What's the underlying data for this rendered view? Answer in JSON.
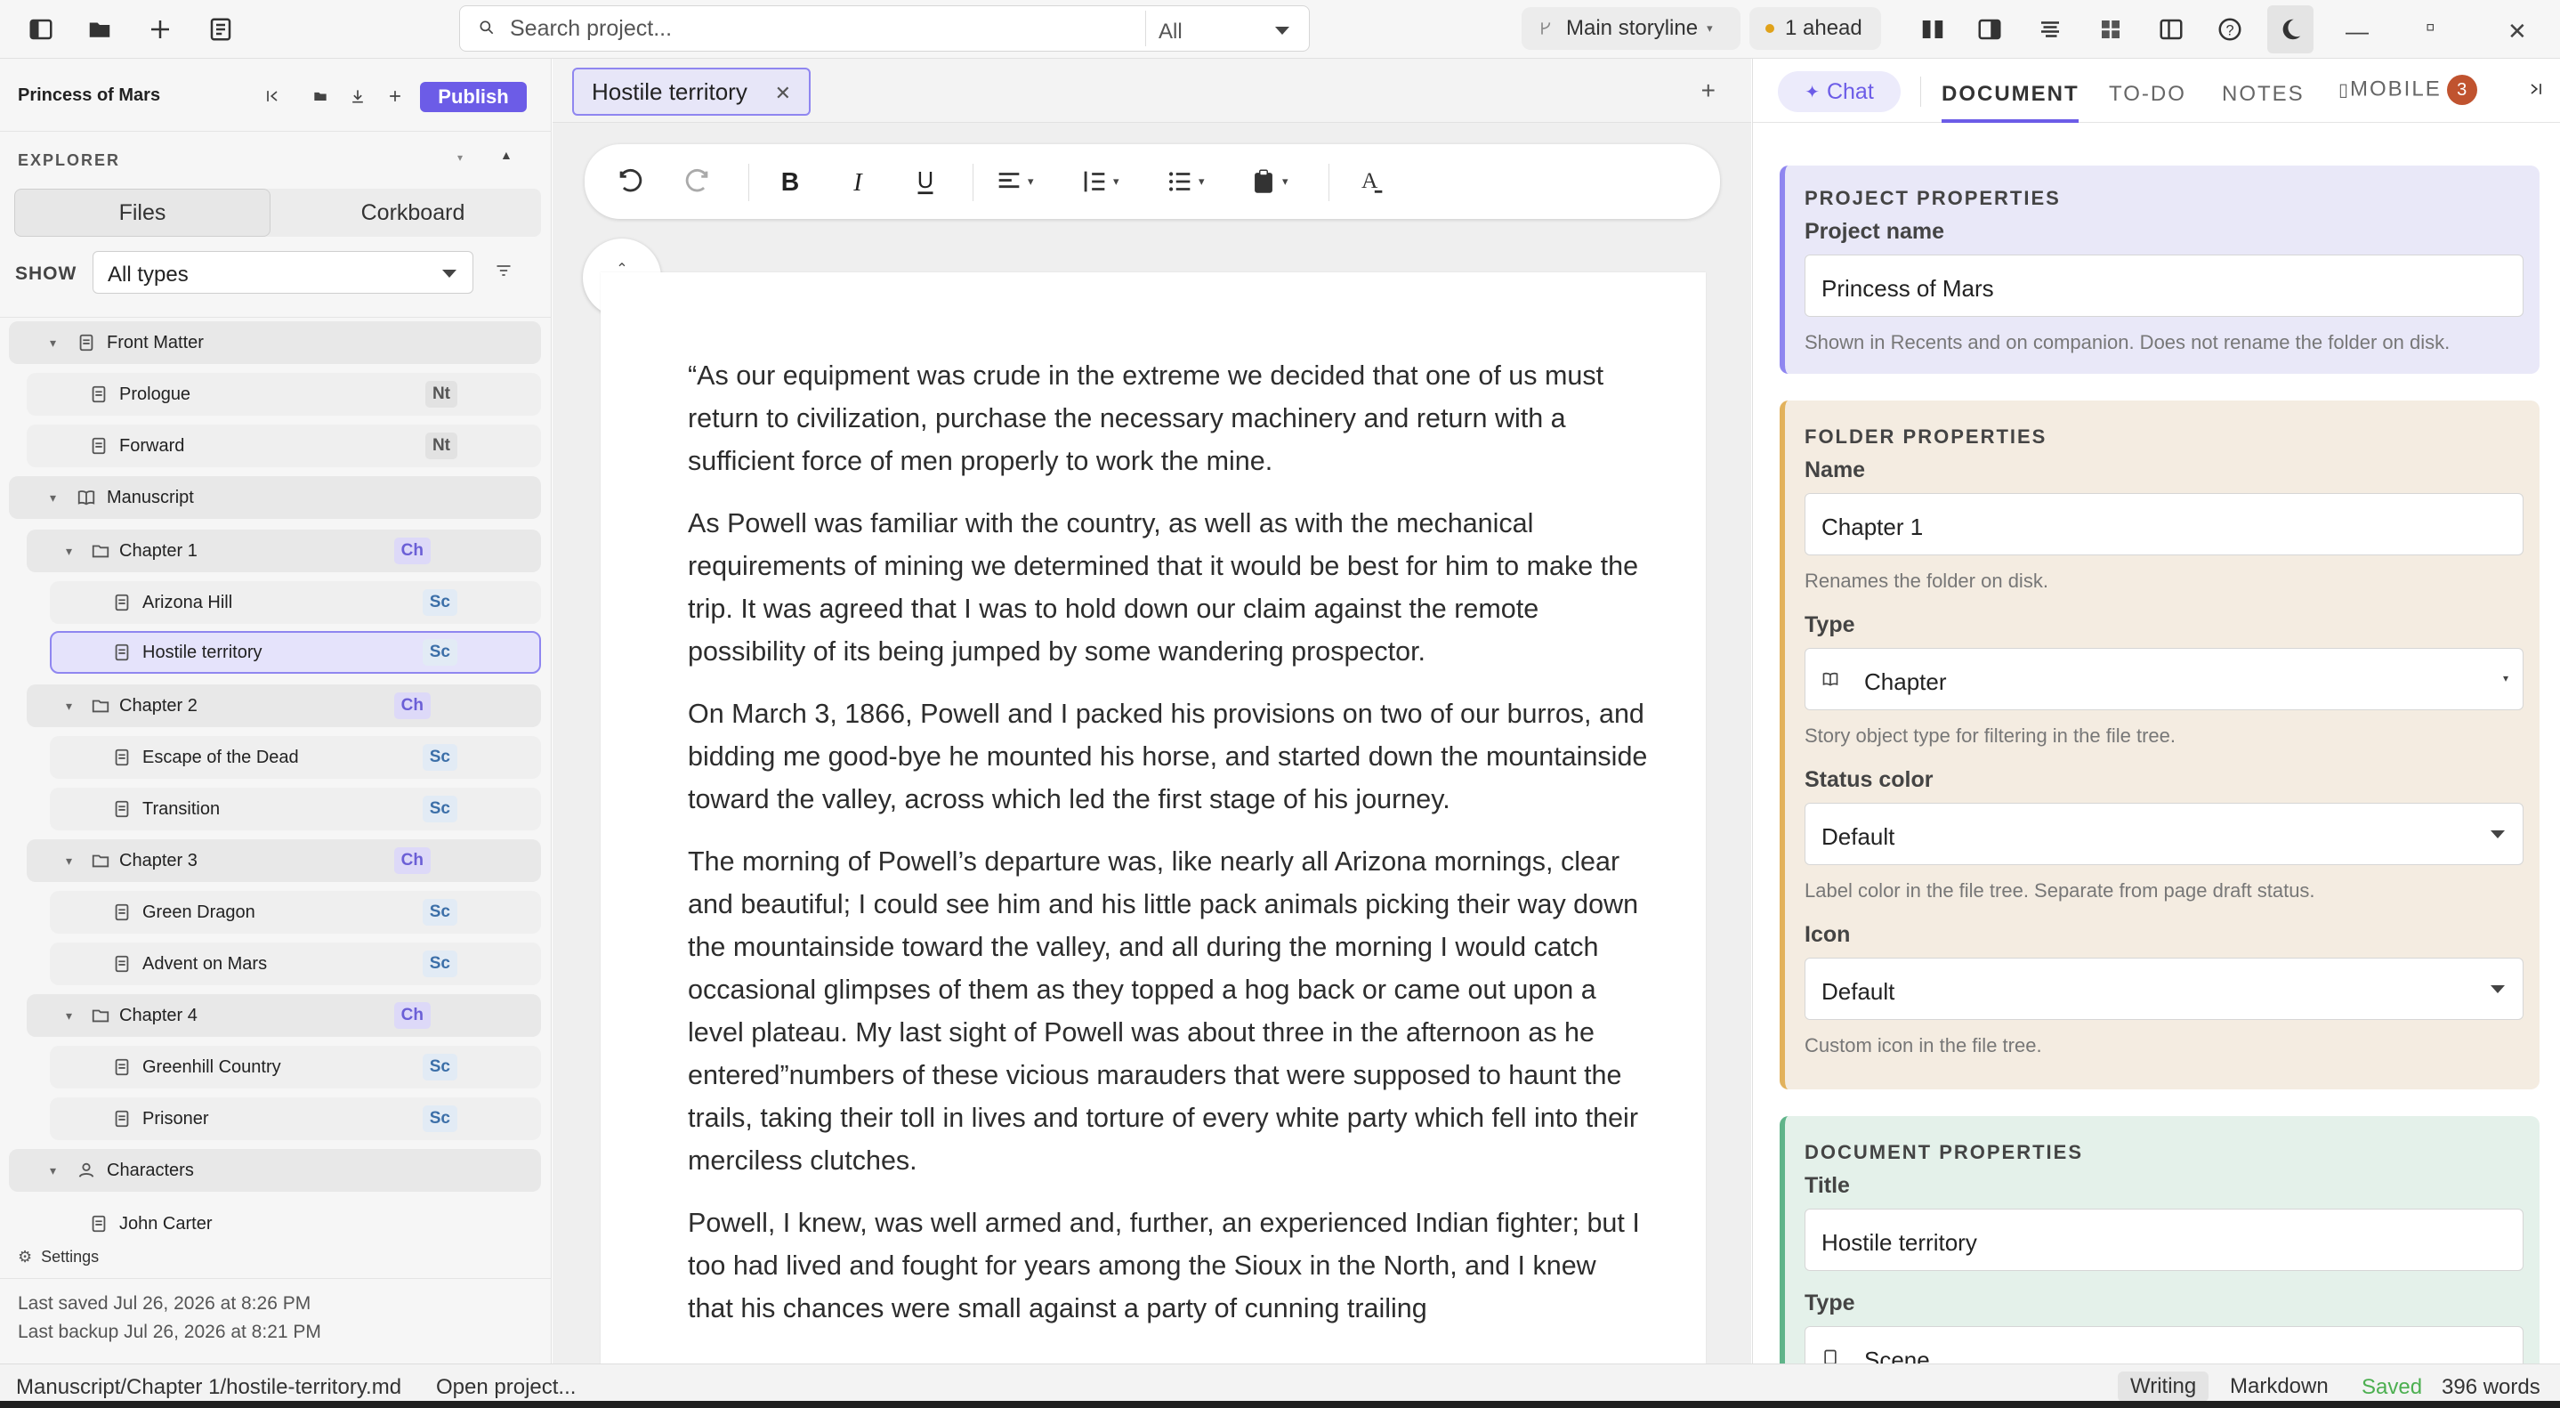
{
  "topbar": {
    "search_placeholder": "Search project...",
    "scope": "All",
    "storyline": "Main storyline",
    "ahead": "1 ahead",
    "accent": "#6c5ce7"
  },
  "sidebar": {
    "project_name": "Princess of Mars",
    "publish_label": "Publish",
    "explorer_label": "EXPLORER",
    "tabs": [
      "Files",
      "Corkboard"
    ],
    "show_label": "SHOW",
    "type_filter": "All types",
    "tree": [
      {
        "label": "Front Matter",
        "kind": "group",
        "icon": "document-icon"
      },
      {
        "label": "Prologue",
        "badge": "Nt",
        "icon": "document-icon"
      },
      {
        "label": "Forward",
        "badge": "Nt",
        "icon": "document-icon"
      },
      {
        "label": "Manuscript",
        "kind": "group",
        "icon": "book-icon"
      },
      {
        "label": "Chapter 1",
        "badge": "Ch",
        "icon": "folder-icon"
      },
      {
        "label": "Arizona Hill",
        "badge": "Sc",
        "icon": "document-icon"
      },
      {
        "label": "Hostile territory",
        "badge": "Sc",
        "icon": "document-icon",
        "selected": true
      },
      {
        "label": "Chapter 2",
        "badge": "Ch",
        "icon": "folder-icon"
      },
      {
        "label": "Escape of the Dead",
        "badge": "Sc",
        "icon": "document-icon"
      },
      {
        "label": "Transition",
        "badge": "Sc",
        "icon": "document-icon"
      },
      {
        "label": "Chapter 3",
        "badge": "Ch",
        "icon": "folder-icon"
      },
      {
        "label": "Green Dragon",
        "badge": "Sc",
        "icon": "document-icon"
      },
      {
        "label": "Advent on Mars",
        "badge": "Sc",
        "icon": "document-icon"
      },
      {
        "label": "Chapter 4",
        "badge": "Ch",
        "icon": "folder-icon"
      },
      {
        "label": "Greenhill Country",
        "badge": "Sc",
        "icon": "document-icon"
      },
      {
        "label": "Prisoner",
        "badge": "Sc",
        "icon": "document-icon"
      },
      {
        "label": "Characters",
        "kind": "group",
        "icon": "person-icon"
      },
      {
        "label": "John Carter",
        "icon": "document-icon"
      }
    ],
    "settings_label": "Settings",
    "last_saved": "Last saved Jul 26, 2026 at 8:26 PM",
    "last_backup": "Last backup Jul 26, 2026 at 8:21 PM"
  },
  "editor": {
    "tab_title": "Hostile territory",
    "page_button": "page",
    "paragraphs": [
      "“As our equipment was crude in the extreme we decided that one of us must return to civilization, purchase the necessary machinery and return with a sufficient force of men properly to work the mine.",
      "As Powell was familiar with the country, as well as with the mechanical requirements of mining we determined that it would be best for him to make the trip. It was agreed that I was to hold down our claim against the remote possibility of its being jumped by some wandering prospector.",
      "On March 3, 1866, Powell and I packed his provisions on two of our burros, and bidding me good-bye he mounted his horse, and started down the mountainside toward the valley, across which led the first stage of his journey.",
      "The morning of Powell’s departure was, like nearly all Arizona mornings, clear and beautiful; I could see him and his little pack animals picking their way down the mountainside toward the valley, and all during the morning I would catch occasional glimpses of them as they topped a hog back or came out upon a level plateau. My last sight of Powell was about three in the afternoon as he entered”numbers of these vicious marauders that were supposed to haunt the trails, taking their toll in lives and torture of every white party which fell into their merciless clutches.",
      "Powell, I knew, was well armed and, further, an experienced Indian fighter; but I too had lived and fought for years among the Sioux in the North, and I knew that his chances were small against a party of cunning trailing"
    ]
  },
  "inspector": {
    "chat_label": "Chat",
    "tabs": [
      "DOCUMENT",
      "TO-DO",
      "NOTES",
      "MOBILE"
    ],
    "mobile_count": "3",
    "project": {
      "heading": "PROJECT PROPERTIES",
      "name_label": "Project name",
      "name_value": "Princess of Mars",
      "name_hint": "Shown in Recents and on companion. Does not rename the folder on disk."
    },
    "folder": {
      "heading": "FOLDER PROPERTIES",
      "name_label": "Name",
      "name_value": "Chapter 1",
      "name_hint": "Renames the folder on disk.",
      "type_label": "Type",
      "type_value": "Chapter",
      "type_hint": "Story object type for filtering in the file tree.",
      "status_label": "Status color",
      "status_value": "Default",
      "status_hint": "Label color in the file tree. Separate from page draft status.",
      "icon_label": "Icon",
      "icon_value": "Default",
      "icon_hint": "Custom icon in the file tree."
    },
    "document": {
      "heading": "DOCUMENT PROPERTIES",
      "title_label": "Title",
      "title_value": "Hostile territory",
      "type_label": "Type",
      "type_value": "Scene"
    }
  },
  "statusbar": {
    "path": "Manuscript/Chapter 1/hostile-territory.md",
    "open_project": "Open project...",
    "modes": [
      "Writing",
      "Markdown"
    ],
    "saved": "Saved",
    "words": "396 words",
    "saved_color": "#4caf50"
  }
}
